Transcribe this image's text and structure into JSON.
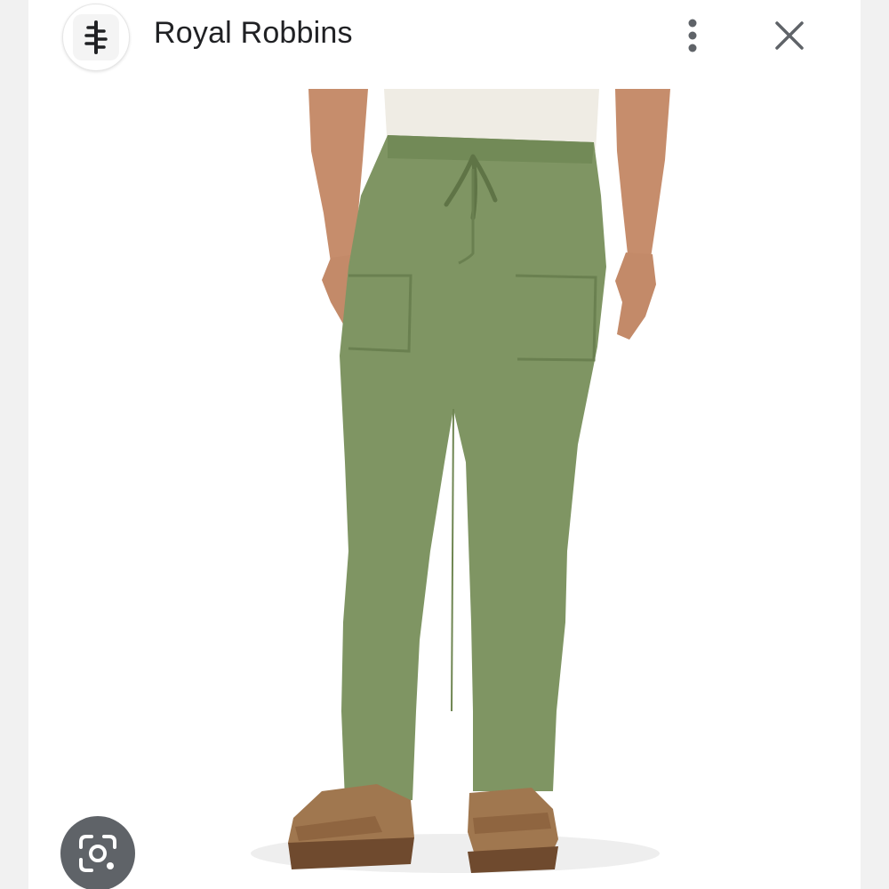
{
  "header": {
    "site_name": "Royal Robbins",
    "logo_icon": "tree-logo-icon",
    "menu_icon": "more-vert-icon",
    "close_icon": "close-icon"
  },
  "image": {
    "subject": "product-photo",
    "pants_color": "#7f9563",
    "shirt_color": "#efece4",
    "sandal_color": "#a0774f"
  },
  "actions": {
    "lens_icon": "google-lens-icon",
    "lens_color": "#5f6368"
  }
}
